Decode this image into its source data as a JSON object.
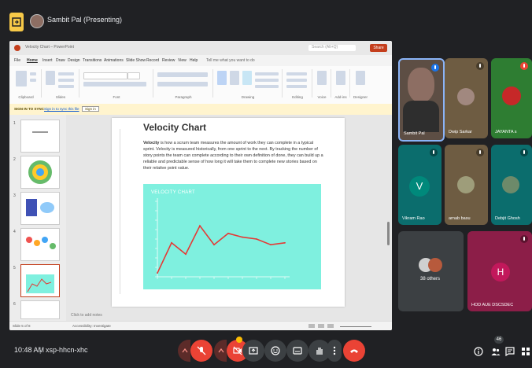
{
  "meeting": {
    "presenter_label": "Sambit Pal (Presenting)",
    "time": "10:48 AM",
    "separator": "|",
    "meeting_code": "xsp-hhcn-xhc",
    "people_count": "46"
  },
  "ppt": {
    "title_text": "Velocity Chart – PowerPoint",
    "search_text": "Search (Alt+Q)",
    "share_label": "Share",
    "tabs": [
      "File",
      "Home",
      "Insert",
      "Draw",
      "Design",
      "Transitions",
      "Animations",
      "Slide Show",
      "Record",
      "Review",
      "View",
      "Help",
      "Tell me what you want to do"
    ],
    "groups": [
      "Clipboard",
      "Slides",
      "Font",
      "Paragraph",
      "Drawing",
      "Editing",
      "Voice",
      "Add-ins",
      "Designer"
    ],
    "infobar_label": "SIGN IN TO SYNC",
    "infobar_text": "Sign in to sync this file",
    "infobar_button": "Sign in",
    "notes_placeholder": "Click to add notes",
    "status_left": "Slide 5 of 8",
    "status_access": "Accessibility: Investigate",
    "slide_numbers": [
      "1",
      "2",
      "3",
      "4",
      "5",
      "6"
    ]
  },
  "slide": {
    "title": "Velocity Chart",
    "body_bold": "Velocity",
    "body": " is how a scrum team measures the amount of work they can complete in a typical sprint. Velocity is measured historically, from one sprint to the next. By tracking the number of story points the team can complete according to their own definition of done, they can build up a reliable and predictable sense of how long it will take them to complete new stories based on their relative point value."
  },
  "chart_data": {
    "type": "line",
    "title": "VELOCITY CHART",
    "x": [
      1,
      2,
      3,
      4,
      5,
      6,
      7,
      8,
      9,
      10
    ],
    "y": [
      2,
      18,
      12,
      27,
      17,
      23,
      21,
      20,
      17,
      18
    ],
    "ylim": [
      0,
      40
    ],
    "grid": false,
    "line_color": "#e53935",
    "background": "#7ff0df"
  },
  "participants": [
    {
      "name": "Sambit Pal",
      "kind": "video",
      "mic": "speaking"
    },
    {
      "name": "Dwip Sarkar",
      "kind": "photo",
      "mic": "muted"
    },
    {
      "name": "JAYANTA s",
      "kind": "photo",
      "mic": "muted-red"
    },
    {
      "name": "Vikram Rao",
      "kind": "letter",
      "letter": "V",
      "mic": "muted"
    },
    {
      "name": "arnab basu",
      "kind": "photo",
      "mic": "muted"
    },
    {
      "name": "Debjit Ghosh",
      "kind": "photo",
      "mic": "muted"
    },
    {
      "name": "38 others",
      "kind": "group"
    },
    {
      "name": "HOD AUE DSCSDEC",
      "kind": "letter",
      "letter": "H",
      "mic": "muted"
    }
  ],
  "colors": {
    "accent_red": "#ea4335",
    "pink_tile": "#8c1e48",
    "teal_tile": "#0b6d6d"
  }
}
